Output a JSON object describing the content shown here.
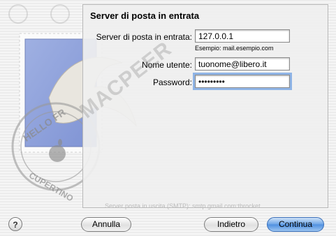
{
  "panel": {
    "title": "Server di posta in entrata",
    "incoming_server": {
      "label": "Server di posta in entrata:",
      "value": "127.0.0.1",
      "hint": "Esempio: mail.esempio.com"
    },
    "username": {
      "label": "Nome utente:",
      "value": "tuonome@libero.it"
    },
    "password": {
      "label": "Password:",
      "value": "•••••••••"
    }
  },
  "buttons": {
    "help": "?",
    "cancel": "Annulla",
    "back": "Indietro",
    "continue": "Continua"
  },
  "watermark_text": "MACPEER",
  "stamp_text": "HELLO FR...CUPERTINO",
  "background_row": "Server posta in uscita (SMTP):  smtp.gmail.com:tbrocket"
}
